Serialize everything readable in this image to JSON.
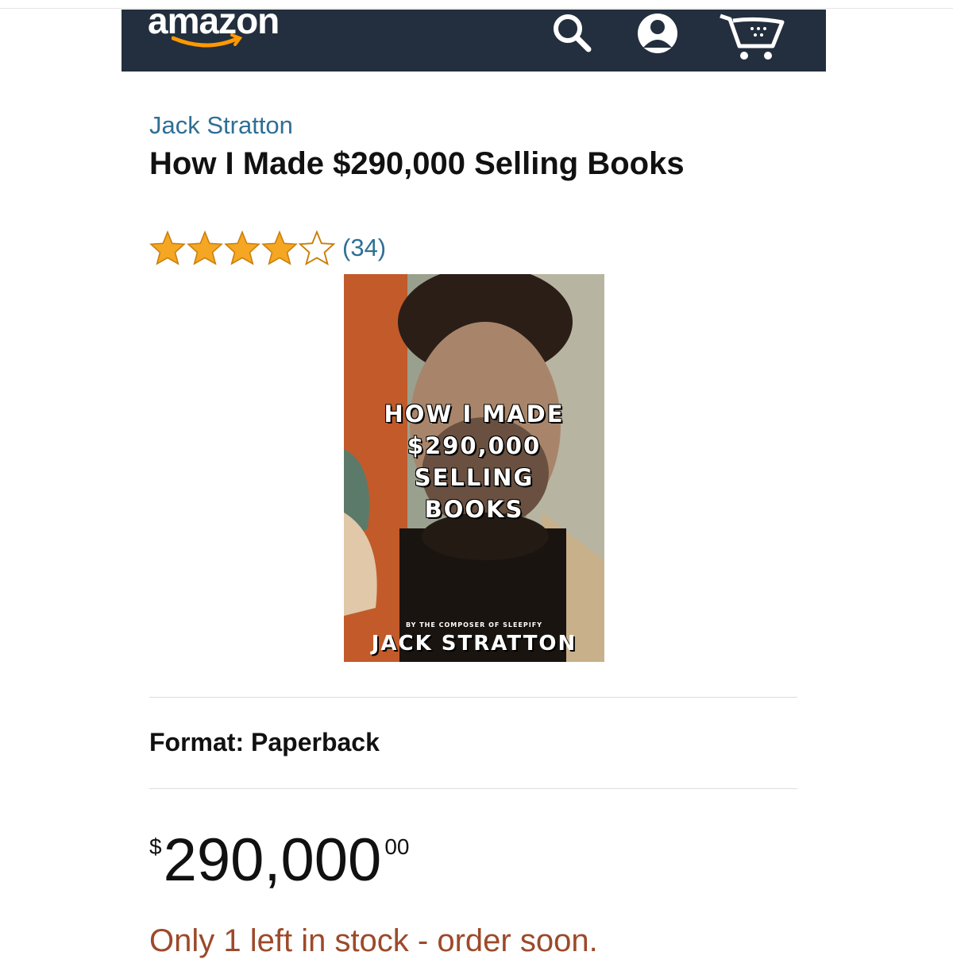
{
  "header": {
    "logo_text": "amazon",
    "icons": [
      "search-icon",
      "account-icon",
      "cart-icon"
    ],
    "background_color": "#232f3e"
  },
  "product": {
    "author": "Jack Stratton",
    "title": "How I Made $290,000 Selling Books",
    "rating": 4,
    "rating_max": 5,
    "review_count": "(34)",
    "cover": {
      "title_lines": [
        "HOW I MADE",
        "$290,000",
        "SELLING",
        "BOOKS"
      ],
      "byline": "BY THE COMPOSER OF SLEEPIFY",
      "author": "JACK STRATTON"
    },
    "format": "Format: Paperback",
    "price": {
      "symbol": "$",
      "whole": "290,000",
      "fraction": "00"
    },
    "stock_message": "Only 1 left in stock - order soon."
  },
  "colors": {
    "link": "#2f6f95",
    "star": "#f5a623",
    "stock": "#9c4a2a"
  }
}
